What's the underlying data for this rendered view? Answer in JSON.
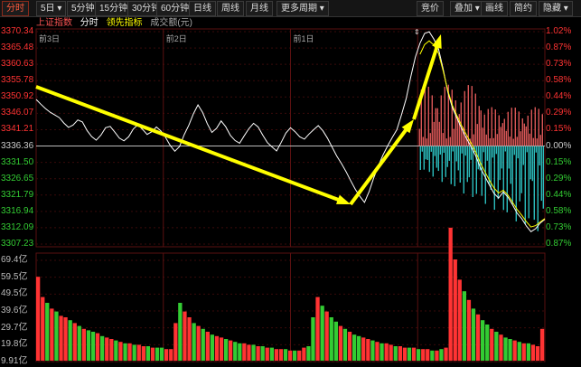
{
  "toolbar": {
    "left": [
      {
        "label": "分时",
        "active": true
      },
      {
        "label": "5日 ▾",
        "active": false
      },
      {
        "label": "5分钟",
        "active": false
      },
      {
        "label": "15分钟",
        "active": false
      },
      {
        "label": "30分钟",
        "active": false
      },
      {
        "label": "60分钟",
        "active": false
      },
      {
        "label": "日线",
        "active": false
      },
      {
        "label": "周线",
        "active": false
      },
      {
        "label": "月线",
        "active": false
      },
      {
        "label": "更多周期 ▾",
        "active": false
      }
    ],
    "right": [
      {
        "label": "竞价"
      },
      {
        "label": "叠加 ▾"
      },
      {
        "label": "画线"
      },
      {
        "label": "简约"
      },
      {
        "label": "隐藏 ▾"
      }
    ]
  },
  "legend": {
    "index": "上证指数",
    "fenshi": "分时",
    "leading": "领先指标",
    "volume": "成交额(元)"
  },
  "colors": {
    "up": "#ff3333",
    "down": "#33cc33",
    "neutral": "#cccccc",
    "line": "#ffffff",
    "leading": "#ffff00",
    "arrow": "#ffff00",
    "bar_pos": "#ff6666",
    "bar_neg": "#33dddd",
    "grid": "#3a0a0a"
  },
  "dates": [
    "前3日",
    "前2日",
    "前1日"
  ],
  "price_axis": {
    "ticks": [
      "3370.34",
      "3365.48",
      "3360.63",
      "3355.78",
      "3350.92",
      "3346.07",
      "3341.21",
      "3336.36",
      "3331.50",
      "3326.65",
      "3321.79",
      "3316.94",
      "3312.09",
      "3307.23"
    ],
    "pct": [
      "1.02%",
      "0.87%",
      "0.73%",
      "0.58%",
      "0.44%",
      "0.29%",
      "0.15%",
      "0.00%",
      "0.15%",
      "0.29%",
      "0.44%",
      "0.58%",
      "0.73%",
      "0.87%"
    ],
    "base_index": 7,
    "min": 3307.23,
    "max": 3370.34
  },
  "volume_axis": {
    "ticks": [
      "69.4亿",
      "59.5亿",
      "49.5亿",
      "39.6亿",
      "29.7亿",
      "19.8亿",
      "9.91亿"
    ]
  },
  "chart_data": {
    "type": "line",
    "series": [
      {
        "values": [
          3350.2,
          3348.8,
          3347.5,
          3346.4,
          3345.6,
          3344.8,
          3343.2,
          3341.9,
          3342.6,
          3344.1,
          3343.5,
          3341.0,
          3339.2,
          3338.1,
          3339.6,
          3341.8,
          3342.2,
          3340.5,
          3338.7,
          3337.9,
          3339.1,
          3341.4,
          3342.7,
          3341.3,
          3339.8,
          3340.6,
          3342.0,
          3340.8,
          3338.9,
          3336.5,
          3334.8,
          3336.2,
          3339.7,
          3342.5,
          3345.9,
          3348.6,
          3346.3,
          3343.0,
          3340.4,
          3341.6,
          3343.8,
          3342.1,
          3339.5,
          3338.0,
          3337.2,
          3339.4,
          3341.5,
          3343.1,
          3342.0,
          3339.6,
          3337.4,
          3336.1,
          3334.9,
          3337.5,
          3340.2,
          3341.8,
          3340.6,
          3339.1,
          3338.4,
          3339.9,
          3341.2,
          3342.4,
          3340.9,
          3338.7,
          3336.0,
          3333.4,
          3331.2,
          3328.8,
          3326.1,
          3323.5,
          3321.4,
          3319.6,
          3322.8,
          3326.9,
          3330.5,
          3333.7,
          3336.4,
          3338.9,
          3341.2,
          3345.6,
          3350.4,
          3356.9,
          3362.8,
          3366.9,
          3369.8,
          3370.3,
          3368.1,
          3365.2,
          3359.3,
          3352.5,
          3347.8,
          3344.6,
          3341.5,
          3338.7,
          3336.2,
          3333.6,
          3330.1,
          3327.4,
          3324.8,
          3322.3,
          3320.9,
          3322.7,
          3321.2,
          3318.9,
          3316.4,
          3314.8,
          3312.6,
          3310.9,
          3311.8,
          3313.5,
          3314.6
        ]
      },
      {
        "values": [
          3349.6,
          3348.2,
          3347.0,
          3346.0,
          3345.2,
          3344.4,
          3343.2,
          3342.2,
          3342.5,
          3343.6,
          3343.2,
          3341.5,
          3340.0,
          3339.0,
          3339.8,
          3341.2,
          3341.6,
          3340.4,
          3339.1,
          3338.5,
          3339.2,
          3340.8,
          3341.9,
          3341.0,
          3339.9,
          3340.4,
          3341.5,
          3340.6,
          3339.2,
          3337.5,
          3336.2,
          3337.1,
          3339.5,
          3341.8,
          3344.6,
          3346.9,
          3345.3,
          3342.8,
          3340.9,
          3341.5,
          3343.1,
          3341.9,
          3340.0,
          3338.8,
          3338.1,
          3339.5,
          3341.0,
          3342.4,
          3341.6,
          3339.9,
          3338.3,
          3337.2,
          3336.3,
          3338.0,
          3339.8,
          3341.0,
          3340.2,
          3339.2,
          3338.7,
          3339.7,
          3340.7,
          3341.6,
          3340.5,
          3338.9,
          3336.9,
          3335.0,
          3333.1,
          3330.9,
          3328.5,
          3326.2,
          3324.3,
          3322.6,
          3324.9,
          3328.0,
          3331.0,
          3333.8,
          3336.2,
          3338.4,
          3340.5,
          3344.2,
          3348.5,
          3354.1,
          3359.4,
          3363.6,
          3366.5,
          3367.6,
          3366.3,
          3363.9,
          3358.7,
          3352.9,
          3348.5,
          3345.3,
          3342.4,
          3339.8,
          3337.3,
          3334.7,
          3331.5,
          3328.8,
          3326.2,
          3323.9,
          3322.4,
          3323.2,
          3321.8,
          3319.7,
          3317.5,
          3315.8,
          3313.9,
          3312.3,
          3312.7,
          3313.8,
          3314.8
        ]
      }
    ],
    "volume": [
      58,
      44,
      40,
      36,
      34,
      31,
      30,
      28,
      26,
      24,
      22,
      21,
      20,
      19,
      17,
      16,
      15,
      14,
      13,
      12,
      12,
      11,
      11,
      10,
      10,
      9,
      9,
      9,
      8,
      8,
      26,
      40,
      34,
      30,
      26,
      24,
      22,
      20,
      18,
      17,
      16,
      15,
      14,
      13,
      12,
      12,
      11,
      11,
      10,
      10,
      9,
      9,
      8,
      8,
      8,
      7,
      7,
      7,
      9,
      10,
      30,
      44,
      38,
      34,
      30,
      27,
      24,
      22,
      20,
      18,
      17,
      16,
      15,
      14,
      13,
      12,
      12,
      11,
      10,
      10,
      9,
      9,
      9,
      8,
      8,
      8,
      7,
      7,
      8,
      9,
      92,
      70,
      56,
      48,
      42,
      36,
      32,
      28,
      25,
      22,
      20,
      18,
      16,
      15,
      14,
      13,
      12,
      12,
      11,
      10,
      22
    ],
    "volume_dir": [
      1,
      1,
      -1,
      1,
      -1,
      1,
      1,
      -1,
      1,
      -1,
      1,
      -1,
      -1,
      1,
      -1,
      1,
      1,
      -1,
      1,
      -1,
      1,
      -1,
      1,
      1,
      -1,
      1,
      -1,
      -1,
      1,
      1,
      1,
      -1,
      1,
      1,
      -1,
      1,
      -1,
      1,
      -1,
      1,
      1,
      -1,
      1,
      -1,
      -1,
      1,
      1,
      -1,
      1,
      -1,
      1,
      -1,
      1,
      1,
      -1,
      1,
      -1,
      1,
      1,
      -1,
      -1,
      1,
      -1,
      1,
      -1,
      -1,
      1,
      -1,
      1,
      -1,
      -1,
      1,
      1,
      -1,
      1,
      -1,
      1,
      1,
      -1,
      1,
      1,
      -1,
      1,
      -1,
      1,
      1,
      -1,
      1,
      -1,
      1,
      1,
      1,
      1,
      -1,
      1,
      -1,
      1,
      -1,
      -1,
      1,
      -1,
      1,
      -1,
      -1,
      1,
      -1,
      1,
      -1,
      1,
      1,
      1
    ],
    "ylim": [
      3307.23,
      3370.34
    ]
  }
}
